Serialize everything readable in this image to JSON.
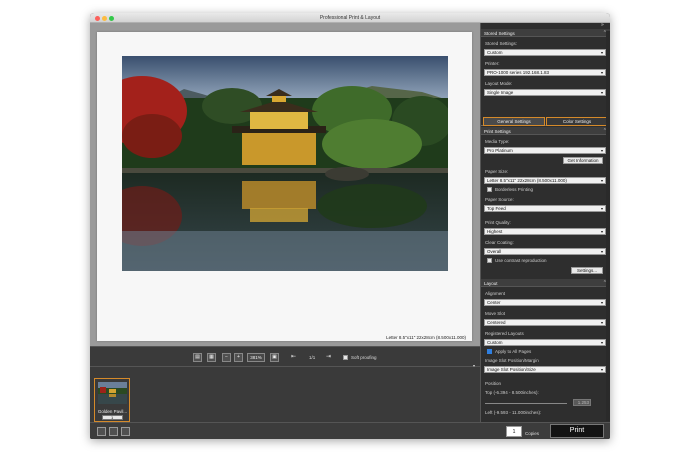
{
  "window": {
    "title": "Professional Print & Layout"
  },
  "preview": {
    "paper_info": "Letter 8.5\"x11\" 22x28cm (8.500x11.000)"
  },
  "toolbar": {
    "zoom_value": "381%",
    "page_indicator": "1/1",
    "soft_proofing_label": "Soft proofing"
  },
  "thumbnail": {
    "label": "Golden Pavil...",
    "stepper_value": "1"
  },
  "panel": {
    "stored_settings": {
      "header": "Stored Settings",
      "stored_label": "Stored Settings:",
      "stored_value": "Custom",
      "printer_label": "Printer:",
      "printer_value": "PRO-1000 series 192.168.1.83",
      "layout_mode_label": "Layout Mode:",
      "layout_mode_value": "Single Image"
    },
    "tabs": {
      "general": "General Settings",
      "color": "Color Settings"
    },
    "print_settings": {
      "header": "Print Settings",
      "media_type_label": "Media Type:",
      "media_type_value": "Pro Platinum",
      "get_information_button": "Get Information",
      "paper_size_label": "Paper Size:",
      "paper_size_value": "Letter 8.5\"x11\" 22x28cm (8.500x11.000)",
      "borderless_label": "Borderless Printing",
      "paper_source_label": "Paper Source:",
      "paper_source_value": "Top Feed",
      "print_quality_label": "Print Quality:",
      "print_quality_value": "Highest",
      "clear_coating_label": "Clear Coating:",
      "clear_coating_value": "Overall",
      "contrast_label": "Use contrast reproduction",
      "settings_button": "Settings..."
    },
    "layout": {
      "header": "Layout",
      "alignment_label": "Alignment",
      "alignment_value": "Center",
      "move_slot_label": "Move Slot",
      "move_slot_value": "Centered",
      "registered_label": "Registered Layouts",
      "registered_value": "Custom",
      "apply_all_label": "Apply to All Pages",
      "image_slot_label": "Image Slot Position/Margin",
      "image_slot_value": "Image Slot Position/Size",
      "position_label": "Position",
      "top_label": "Top (-6.394 - 8.500inches):",
      "top_value": "1.253",
      "left_label": "Left (-9.593 - 11.000inches):",
      "left_value": "0.704"
    }
  },
  "bottombar": {
    "copies_value": "1",
    "copies_label": "Copies",
    "print_button": "Print"
  },
  "colors": {
    "accent": "#d58a2a",
    "window_bg": "#2f2f2f",
    "preview_bg": "#9a9a9a",
    "checkbox_on": "#2f7fe0"
  }
}
